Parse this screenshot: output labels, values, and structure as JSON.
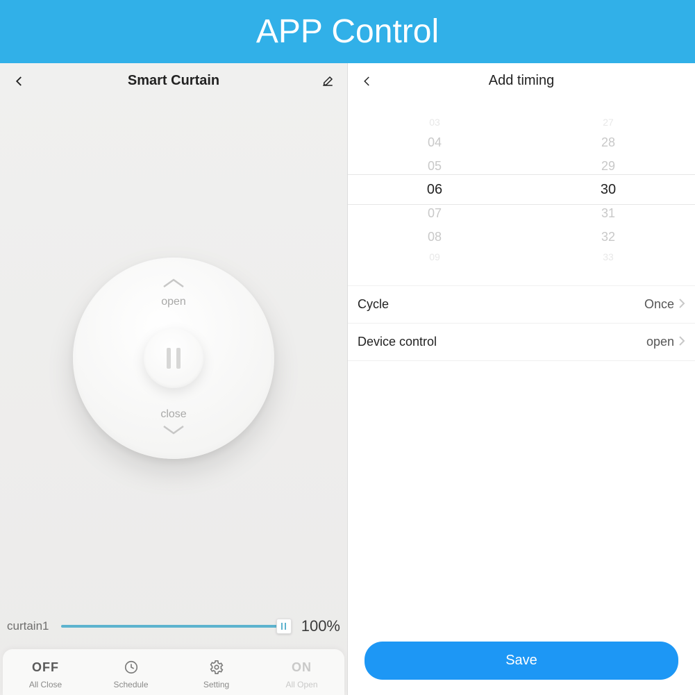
{
  "banner": "APP Control",
  "left": {
    "title": "Smart Curtain",
    "dial": {
      "open": "open",
      "close": "close"
    },
    "slider": {
      "name": "curtain1",
      "percent": "100%"
    },
    "bottom": {
      "off": "OFF",
      "all_close": "All Close",
      "schedule": "Schedule",
      "setting": "Setting",
      "on": "ON",
      "all_open": "All Open"
    }
  },
  "right": {
    "title": "Add timing",
    "picker": {
      "hours": [
        "03",
        "04",
        "05",
        "06",
        "07",
        "08",
        "09"
      ],
      "mins": [
        "27",
        "28",
        "29",
        "30",
        "31",
        "32",
        "33"
      ]
    },
    "rows": {
      "cycle_label": "Cycle",
      "cycle_value": "Once",
      "device_label": "Device control",
      "device_value": "open"
    },
    "save": "Save"
  }
}
